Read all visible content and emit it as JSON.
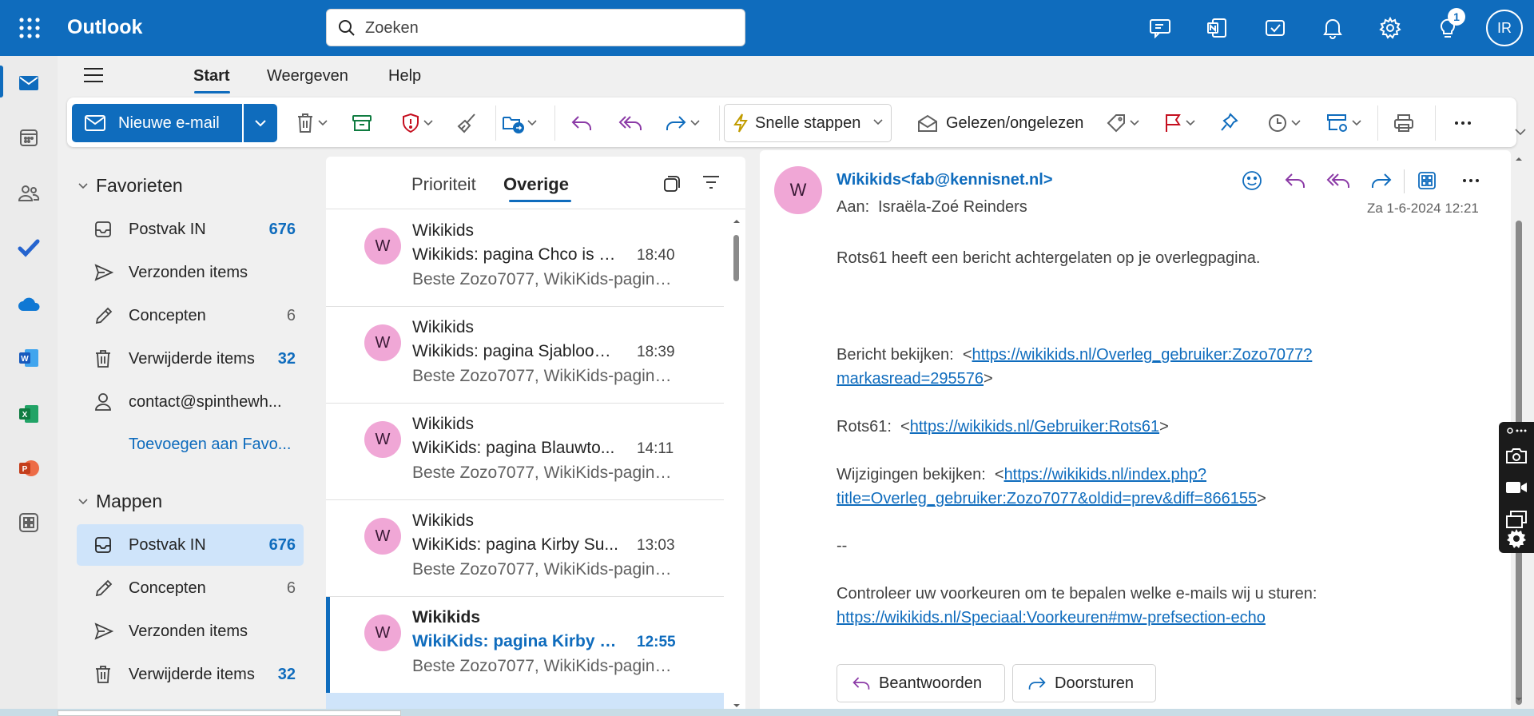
{
  "app": {
    "name": "Outlook"
  },
  "search": {
    "placeholder": "Zoeken"
  },
  "topbar": {
    "notification_count": "1",
    "user_initials": "IR"
  },
  "ribbon": {
    "tabs": [
      "Start",
      "Weergeven",
      "Help"
    ],
    "active_tab": "Start"
  },
  "toolbar": {
    "new_mail": "Nieuwe e-mail",
    "quick_steps": "Snelle stappen",
    "read_unread": "Gelezen/ongelezen"
  },
  "favorites": {
    "title": "Favorieten",
    "items": [
      {
        "label": "Postvak IN",
        "count": "676"
      },
      {
        "label": "Verzonden items",
        "count": ""
      },
      {
        "label": "Concepten",
        "count": "6"
      },
      {
        "label": "Verwijderde items",
        "count": "32"
      },
      {
        "label": "contact@spinthewh...",
        "count": ""
      }
    ],
    "add_link": "Toevoegen aan Favo..."
  },
  "folders": {
    "title": "Mappen",
    "items": [
      {
        "label": "Postvak IN",
        "count": "676"
      },
      {
        "label": "Concepten",
        "count": "6"
      },
      {
        "label": "Verzonden items",
        "count": ""
      },
      {
        "label": "Verwijderde items",
        "count": "32"
      }
    ]
  },
  "message_list": {
    "tabs": [
      "Prioriteit",
      "Overige"
    ],
    "active_tab": "Overige",
    "messages": [
      {
        "initial": "W",
        "from": "Wikikids",
        "subject": "Wikikids: pagina Chco is v...",
        "time": "18:40",
        "preview": "Beste Zozo7077, WikiKids-pagina...",
        "unread": false
      },
      {
        "initial": "W",
        "from": "Wikikids",
        "subject": "Wikikids: pagina Sjabloon:...",
        "time": "18:39",
        "preview": "Beste Zozo7077, WikiKids-pagina...",
        "unread": false
      },
      {
        "initial": "W",
        "from": "Wikikids",
        "subject": "WikiKids: pagina Blauwto...",
        "time": "14:11",
        "preview": "Beste Zozo7077, WikiKids-pagina...",
        "unread": false
      },
      {
        "initial": "W",
        "from": "Wikikids",
        "subject": "WikiKids: pagina Kirby Su...",
        "time": "13:03",
        "preview": "Beste Zozo7077, WikiKids-pagina...",
        "unread": false
      },
      {
        "initial": "W",
        "from": "Wikikids",
        "subject": "WikiKids: pagina Kirby S...",
        "time": "12:55",
        "preview": "Beste Zozo7077, WikiKids-pagina...",
        "unread": true
      }
    ]
  },
  "reading": {
    "avatar_initial": "W",
    "from": "Wikikids<fab@kennisnet.nl>",
    "to_label": "Aan:",
    "to": "Israëla-Zoé Reinders",
    "date": "Za 1-6-2024 12:21",
    "intro": "Rots61 heeft een bericht achtergelaten op je overlegpagina.",
    "view_label": "Bericht bekijken:",
    "view_link_1": "https://wikikids.nl/Overleg_gebruiker:Zozo7077?",
    "view_link_2": "markasread=295576",
    "user_label": "Rots61:",
    "user_link": "https://wikikids.nl/Gebruiker:Rots61",
    "changes_label": "Wijzigingen bekijken:",
    "changes_link_1": "https://wikikids.nl/index.php?",
    "changes_link_2": "title=Overleg_gebruiker:Zozo7077&oldid=prev&diff=866155",
    "separator": "--",
    "prefs_text": "Controleer uw voorkeuren om te bepalen welke e-mails wij u sturen:",
    "prefs_link": "https://wikikids.nl/Speciaal:Voorkeuren#mw-prefsection-echo",
    "reply_button": "Beantwoorden",
    "forward_button": "Doorsturen"
  },
  "colors": {
    "brand": "#0f6cbd",
    "avatar": "#f0a7d6",
    "selected": "#cfe4fa"
  }
}
